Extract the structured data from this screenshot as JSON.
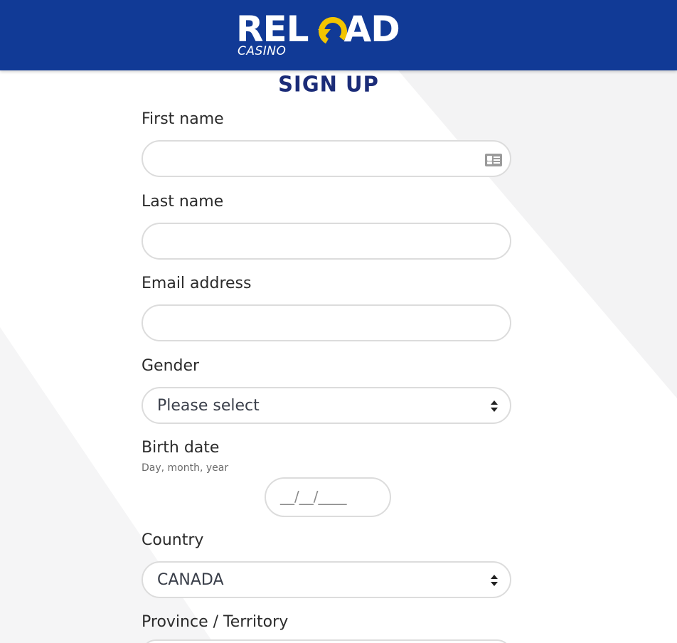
{
  "colors": {
    "header_bg": "#113a96",
    "logo_accent": "#f2c500",
    "title": "#1b2c78",
    "field_border": "#dcdcdc",
    "label_text": "#2b2b2b"
  },
  "header": {
    "logo_word_left": "REL",
    "logo_word_right": "AD",
    "logo_subtitle": "CASINO",
    "logo_icon": "reload-arrow-icon"
  },
  "form": {
    "title": "SIGN UP",
    "first_name": {
      "label": "First name",
      "value": "",
      "icon": "id-card-icon"
    },
    "last_name": {
      "label": "Last name",
      "value": ""
    },
    "email": {
      "label": "Email address",
      "value": ""
    },
    "gender": {
      "label": "Gender",
      "selected": "Please select",
      "icon": "sort-arrows-icon"
    },
    "birth_date": {
      "label": "Birth date",
      "hint": "Day, month, year",
      "mask": "__/__/____"
    },
    "country": {
      "label": "Country",
      "selected": "CANADA",
      "icon": "sort-arrows-icon"
    },
    "province": {
      "label": "Province / Territory"
    }
  }
}
